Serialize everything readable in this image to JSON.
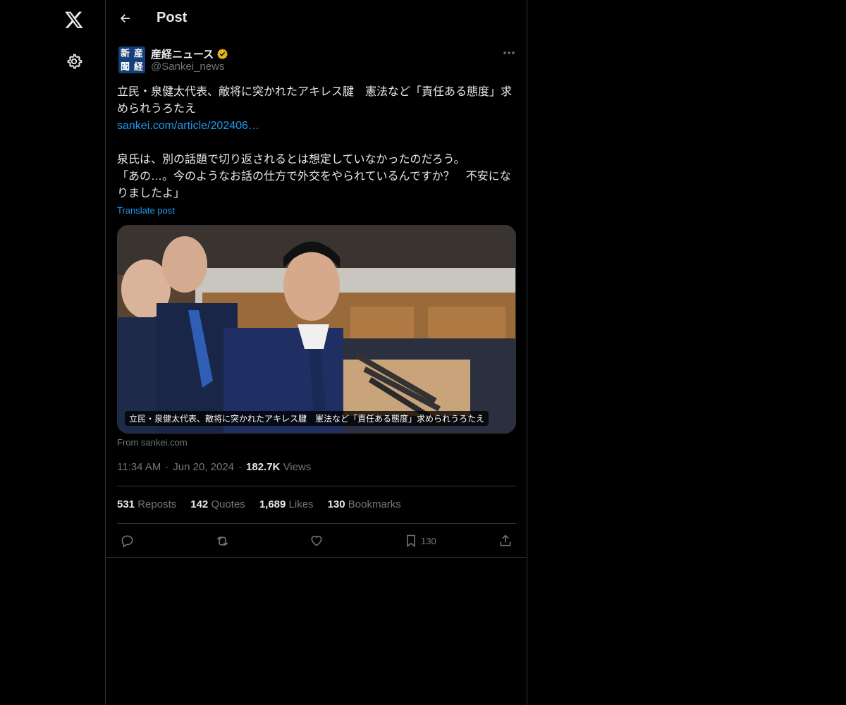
{
  "header": {
    "title": "Post"
  },
  "nav": {
    "logo_icon": "x-logo-icon",
    "settings_icon": "gear-icon"
  },
  "author": {
    "display_name": "産経ニュース",
    "handle": "@Sankei_news",
    "verified_color": "#e2b719",
    "avatar_chars": [
      "新",
      "産",
      "聞",
      "経"
    ]
  },
  "post": {
    "text_line1": "立民・泉健太代表、敵将に突かれたアキレス腱　憲法など「責任ある態度」求められうろたえ",
    "link": "sankei.com/article/202406…",
    "text_para2": "泉氏は、別の話題で切り返されるとは想定していなかったのだろう。\n「あの…。今のようなお話の仕方で外交をやられているんですか？　不安になりましたよ」",
    "translate_label": "Translate post"
  },
  "card": {
    "caption": "立民・泉健太代表、敵将に突かれたアキレス腱　憲法など「責任ある態度」求められうろたえ",
    "from": "From sankei.com"
  },
  "meta": {
    "time": "11:34 AM",
    "date": "Jun 20, 2024",
    "views_count": "182.7K",
    "views_label": "Views"
  },
  "stats": {
    "reposts_count": "531",
    "reposts_label": "Reposts",
    "quotes_count": "142",
    "quotes_label": "Quotes",
    "likes_count": "1,689",
    "likes_label": "Likes",
    "bookmarks_count": "130",
    "bookmarks_label": "Bookmarks"
  },
  "actions": {
    "bookmark_count": "130"
  },
  "colors": {
    "link": "#1d9bf0",
    "muted": "#71767b",
    "border": "#2f3336"
  }
}
